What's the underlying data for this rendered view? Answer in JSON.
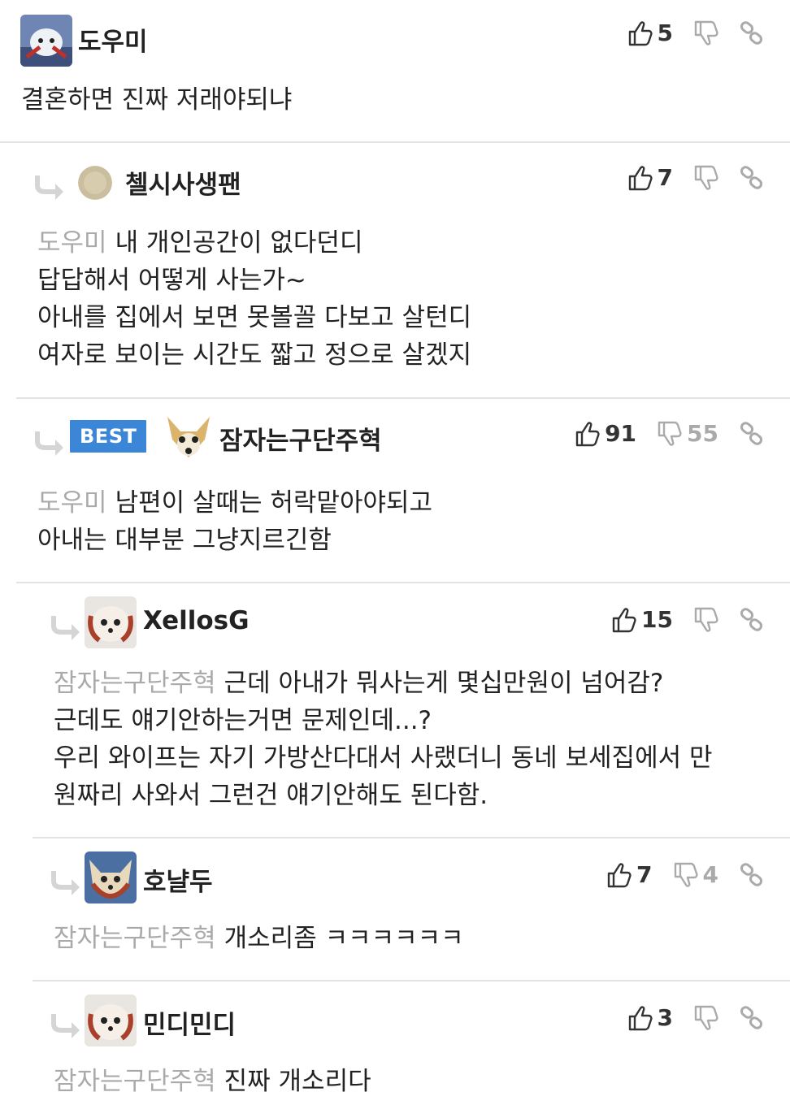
{
  "comments": [
    {
      "author": "도우미",
      "likes": "5",
      "dislikes": "",
      "mention": "",
      "lines": [
        "결혼하면 진짜 저래야되냐"
      ]
    },
    {
      "author": "첼시사생팬",
      "likes": "7",
      "dislikes": "",
      "mention": "도우미",
      "lines": [
        "내 개인공간이 없다던디",
        "답답해서 어떻게 사는가~",
        "아내를 집에서 보면 못볼꼴 다보고 살턴디",
        "여자로 보이는 시간도 짧고 정으로 살겠지"
      ]
    },
    {
      "author": "잠자는구단주혁",
      "badge": "BEST",
      "likes": "91",
      "dislikes": "55",
      "mention": "도우미",
      "lines": [
        "남편이 살때는 허락맡아야되고",
        "아내는 대부분 그냥지르긴함"
      ]
    },
    {
      "author": "XellosG",
      "likes": "15",
      "dislikes": "",
      "mention": "잠자는구단주혁",
      "lines": [
        "근데 아내가 뭐사는게 몇십만원이 넘어감?",
        "근데도 얘기안하는거면 문제인데...?",
        "우리 와이프는 자기 가방산다대서 사랬더니 동네 보세집에서 만",
        "원짜리 사와서 그런건 얘기안해도 된다함."
      ]
    },
    {
      "author": "호냘두",
      "likes": "7",
      "dislikes": "4",
      "mention": "잠자는구단주혁",
      "lines": [
        "개소리좀 ㅋㅋㅋㅋㅋㅋ"
      ]
    },
    {
      "author": "민디민디",
      "likes": "3",
      "dislikes": "",
      "mention": "잠자는구단주혁",
      "lines": [
        "진짜 개소리다"
      ]
    }
  ],
  "colors": {
    "best_badge": "#3b86d6",
    "mention": "#aaaaaa",
    "separator": "#e3e3e3"
  },
  "icons": {
    "like": "thumbs-up-icon",
    "dislike": "thumbs-down-icon",
    "link": "link-icon",
    "reply": "reply-arrow-icon"
  }
}
